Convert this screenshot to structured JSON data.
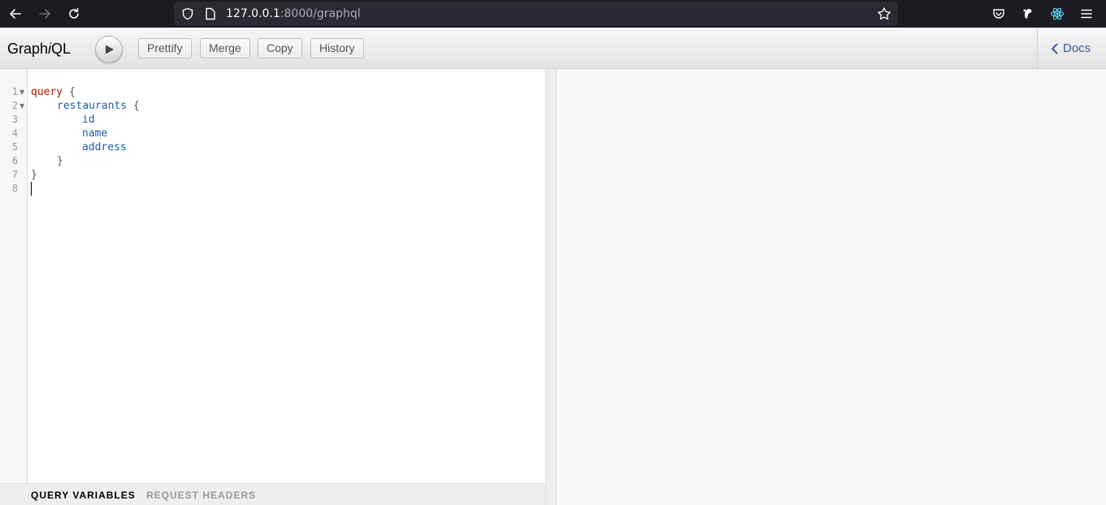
{
  "browser": {
    "url_host": "127.0.0.1",
    "url_rest": ":8000/graphql"
  },
  "toolbar": {
    "logo_prefix": "Graph",
    "logo_i": "i",
    "logo_suffix": "QL",
    "buttons": [
      "Prettify",
      "Merge",
      "Copy",
      "History"
    ],
    "docs_label": "Docs"
  },
  "editor": {
    "line_numbers": [
      "1",
      "2",
      "3",
      "4",
      "5",
      "6",
      "7",
      "8"
    ],
    "lines": {
      "l1_kw": "query",
      "l1_punct": " {",
      "l2_field": "restaurants",
      "l2_punct": " {",
      "l3_field": "id",
      "l4_field": "name",
      "l5_field": "address",
      "l6_punct": "}",
      "l7_punct": "}"
    }
  },
  "bottom_tabs": {
    "variables": "Query Variables",
    "headers": "Request Headers"
  },
  "colors": {
    "keyword": "#B11A04",
    "field": "#1F61A0",
    "docs_link": "#3b5998"
  }
}
